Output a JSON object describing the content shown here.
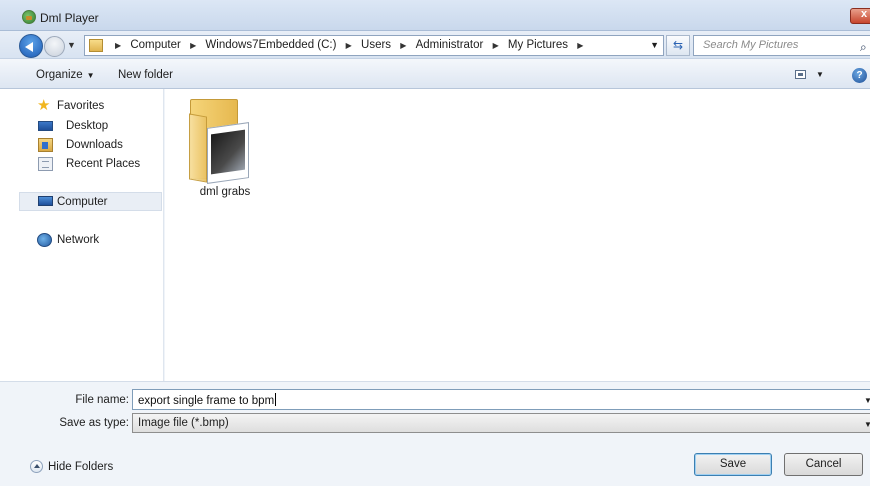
{
  "window": {
    "title": "Dml Player"
  },
  "address": {
    "crumbs": [
      "Computer",
      "Windows7Embedded (C:)",
      "Users",
      "Administrator",
      "My Pictures"
    ],
    "search_placeholder": "Search My Pictures"
  },
  "toolbar": {
    "organize_label": "Organize",
    "new_folder_label": "New folder"
  },
  "nav": {
    "favorites_label": "Favorites",
    "favorites": [
      {
        "label": "Desktop",
        "icon": "desktop-icon"
      },
      {
        "label": "Downloads",
        "icon": "downloads-icon"
      },
      {
        "label": "Recent Places",
        "icon": "recent-places-icon"
      }
    ],
    "computer_label": "Computer",
    "network_label": "Network"
  },
  "content": {
    "items": [
      {
        "name": "dml grabs",
        "type": "folder"
      }
    ]
  },
  "form": {
    "file_name_label": "File name:",
    "file_name_value": "export single frame to bpm",
    "save_as_type_label": "Save as type:",
    "save_as_type_value": "Image file (*.bmp)"
  },
  "footer": {
    "hide_folders_label": "Hide Folders",
    "save_label": "Save",
    "cancel_label": "Cancel"
  }
}
